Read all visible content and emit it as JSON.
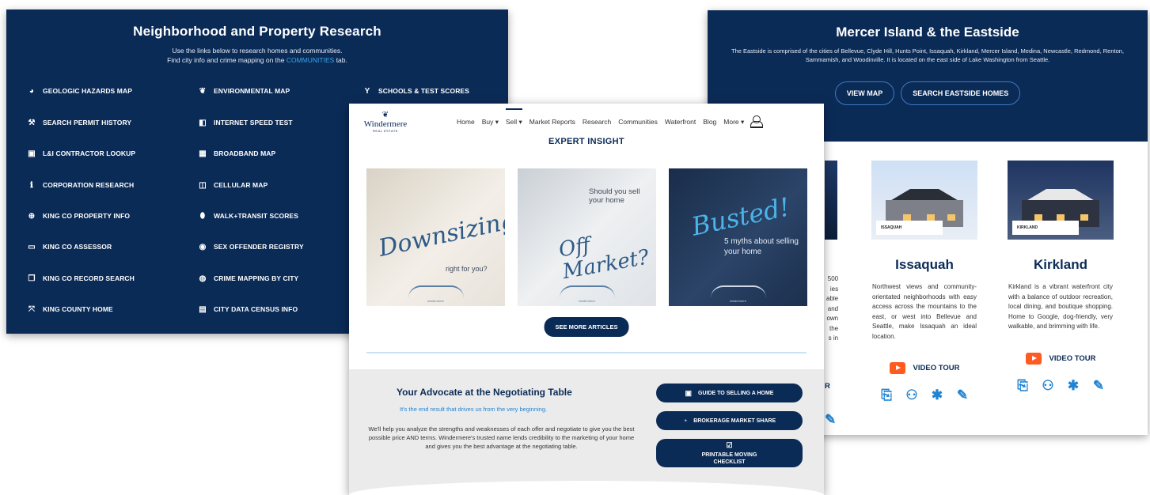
{
  "left_panel": {
    "title": "Neighborhood and Property Research",
    "subtitle_line1": "Use the links below to research homes and communities.",
    "subtitle_line2_prefix": "Find city info and crime mapping on the",
    "subtitle_link": "COMMUNITIES",
    "subtitle_line2_suffix": "tab.",
    "col1": [
      {
        "icon": "globe-icon",
        "glyph": "◕",
        "label": "GEOLOGIC HAZARDS MAP"
      },
      {
        "icon": "tools-icon",
        "glyph": "⚒",
        "label": "SEARCH PERMIT HISTORY"
      },
      {
        "icon": "contract-icon",
        "glyph": "▣",
        "label": "L&I CONTRACTOR LOOKUP"
      },
      {
        "icon": "info-icon",
        "glyph": "ℹ",
        "label": "CORPORATION RESEARCH"
      },
      {
        "icon": "search-icon",
        "glyph": "⊕",
        "label": "KING CO PROPERTY INFO"
      },
      {
        "icon": "id-card-icon",
        "glyph": "▭",
        "label": "KING CO ASSESSOR"
      },
      {
        "icon": "documents-icon",
        "glyph": "❐",
        "label": "KING CO RECORD SEARCH"
      },
      {
        "icon": "expand-icon",
        "glyph": "⤧",
        "label": "KING COUNTY HOME"
      }
    ],
    "col2": [
      {
        "icon": "leaf-icon",
        "glyph": "❦",
        "label": "ENVIRONMENTAL MAP"
      },
      {
        "icon": "speed-icon",
        "glyph": "◧",
        "label": "INTERNET SPEED TEST"
      },
      {
        "icon": "broadband-icon",
        "glyph": "▦",
        "label": "BROADBAND MAP"
      },
      {
        "icon": "cellular-icon",
        "glyph": "◫",
        "label": "CELLULAR MAP"
      },
      {
        "icon": "location-pin-icon",
        "glyph": "⬮",
        "label": "WALK+TRANSIT SCORES"
      },
      {
        "icon": "eye-icon",
        "glyph": "◉",
        "label": "SEX OFFENDER REGISTRY"
      },
      {
        "icon": "crime-icon",
        "glyph": "◍",
        "label": "CRIME MAPPING BY CITY"
      },
      {
        "icon": "census-icon",
        "glyph": "▤",
        "label": "CITY DATA CENSUS INFO"
      }
    ],
    "col3": [
      {
        "icon": "school-icon",
        "glyph": "Y",
        "label": "SCHOOLS & TEST SCORES"
      }
    ]
  },
  "right_panel": {
    "title": "Mercer Island & the Eastside",
    "description": "The Eastside is comprised of the cities of Bellevue, Clyde Hill, Hunts Point, Issaquah, Kirkland, Mercer Island, Medina, Newcastle, Redmond, Renton, Sammamish, and Woodinville. It is located on the east side of Lake Washington from Seattle.",
    "buttons": [
      "VIEW MAP",
      "SEARCH EASTSIDE HOMES"
    ],
    "partial_text": [
      "500",
      "ies",
      "able",
      "and",
      "own",
      "the",
      "s in"
    ],
    "partial_r": "R",
    "cities": [
      {
        "name": "Issaquah",
        "tag": "ISSAQUAH",
        "text": "Northwest views and community-orientated neighborhoods with easy access across the mountains to the east, or west into Bellevue and Seattle, make Issaquah an ideal location.",
        "video": "VIDEO TOUR"
      },
      {
        "name": "Kirkland",
        "tag": "KIRKLAND",
        "text": "Kirkland is a vibrant waterfront city with a balance of outdoor recreation, local dining, and boutique shopping. Home to Google, dog-friendly, very walkable, and brimming with life.",
        "video": "VIDEO TOUR"
      }
    ],
    "action_icons": [
      "document-icon",
      "community-icon",
      "star-icon",
      "pencil-icon"
    ],
    "action_glyphs": [
      "⎘",
      "⚇",
      "✱",
      "✎"
    ]
  },
  "center_panel": {
    "logo": {
      "word": "Windermere",
      "sub": "REAL ESTATE"
    },
    "nav": [
      {
        "label": "Home"
      },
      {
        "label": "Buy ▾"
      },
      {
        "label": "Sell ▾",
        "active": true
      },
      {
        "label": "Market Reports"
      },
      {
        "label": "Research"
      },
      {
        "label": "Communities"
      },
      {
        "label": "Waterfront"
      },
      {
        "label": "Blog"
      },
      {
        "label": "More ▾"
      }
    ],
    "section_title": "EXPERT INSIGHT",
    "cards": [
      {
        "script": "Downsizing",
        "small": "right for you?",
        "brand": "windermere"
      },
      {
        "small": "Should you sell your home",
        "script": "Off Market?",
        "brand": "windermere"
      },
      {
        "script": "Busted!",
        "small": "5 myths about selling your home",
        "brand": "windermere"
      }
    ],
    "see_more": "SEE MORE ARTICLES",
    "advocate": {
      "title": "Your Advocate at the Negotiating Table",
      "subtitle": "It's the end result that drives us from the very beginning.",
      "body": "We'll help you analyze the strengths and weaknesses of each offer and negotiate to give you the best possible price AND terms. Windermere's trusted name lends credibility to the marketing of your home and gives you the best advantage at the negotiating table."
    },
    "side_buttons": [
      {
        "icon": "book-icon",
        "glyph": "▣",
        "label": "GUIDE TO SELLING A HOME"
      },
      {
        "icon": "chart-pie-icon",
        "glyph": "◔",
        "label": "BROKERAGE MARKET SHARE"
      },
      {
        "icon": "checklist-icon",
        "glyph": "☑",
        "label": "PRINTABLE MOVING CHECKLIST"
      }
    ]
  },
  "colors": {
    "navy": "#0b2b57",
    "accent_blue": "#1f84d4",
    "link_blue": "#38a6e8",
    "youtube": "#ff5a1f"
  }
}
